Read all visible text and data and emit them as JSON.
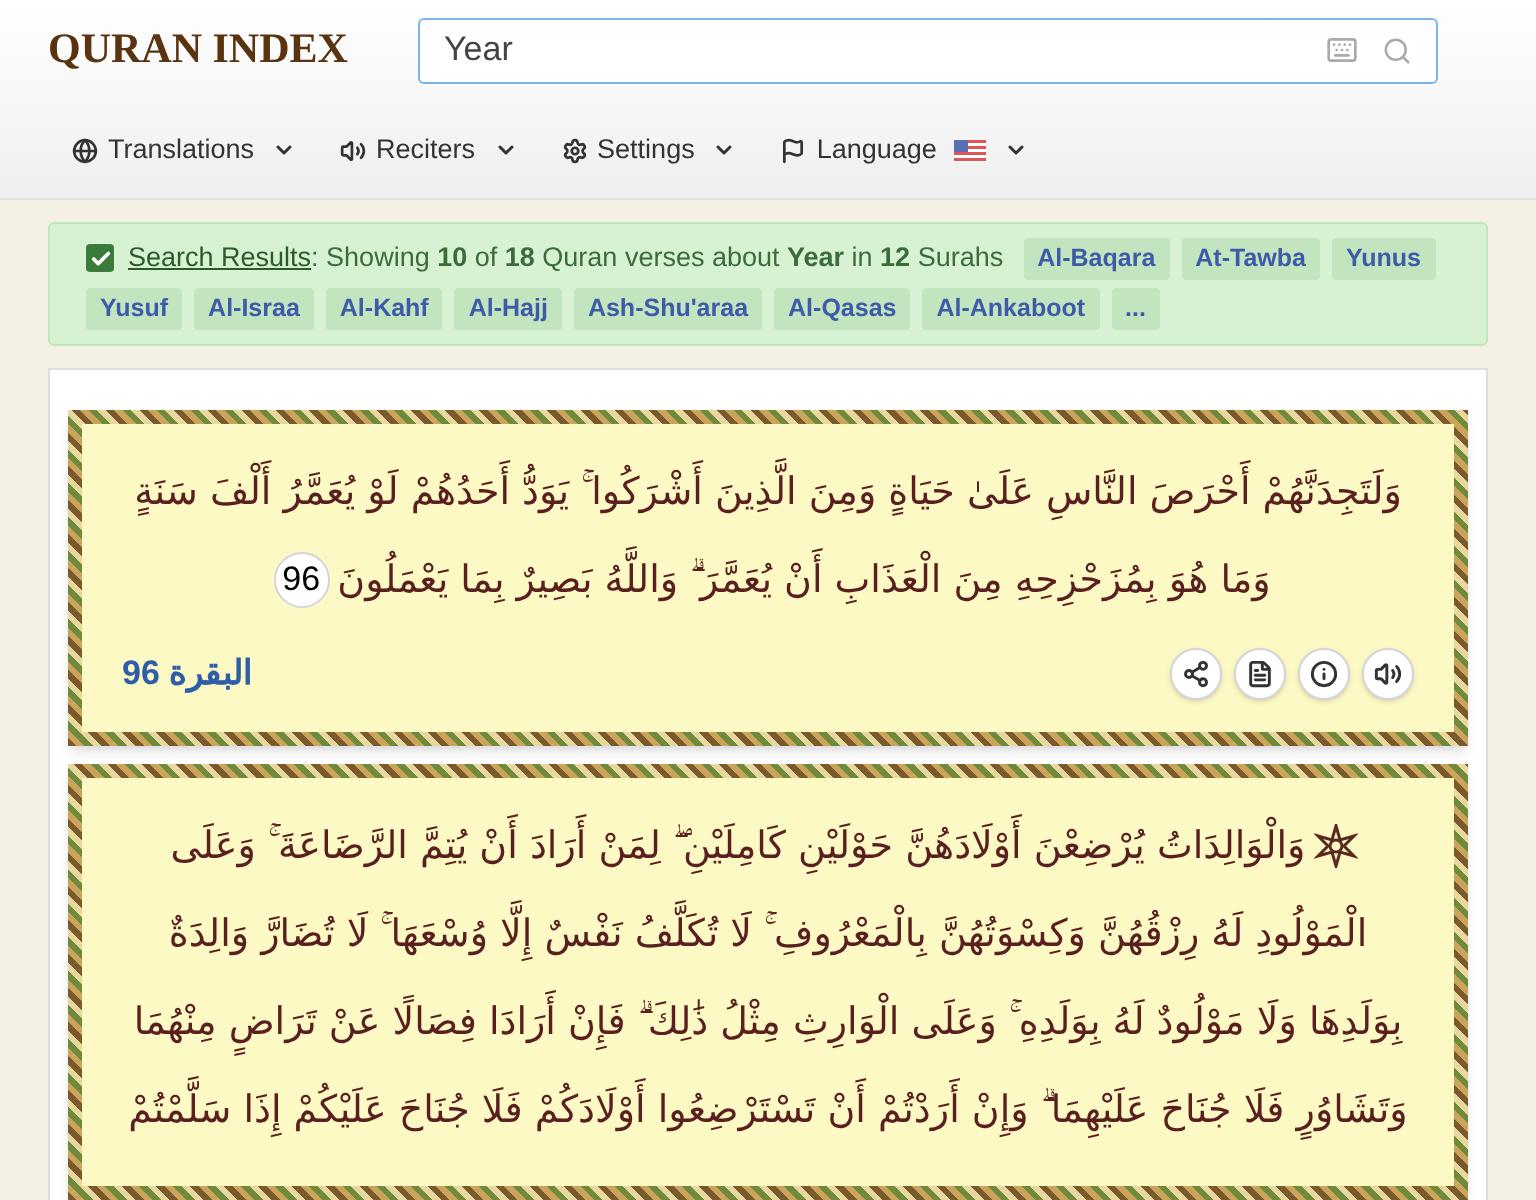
{
  "logo": "QURAN INDEX",
  "search": {
    "value": "Year"
  },
  "menu": [
    {
      "label": "Translations",
      "flag": false
    },
    {
      "label": "Reciters",
      "flag": false
    },
    {
      "label": "Settings",
      "flag": false
    },
    {
      "label": "Language",
      "flag": true
    }
  ],
  "results": {
    "checked": true,
    "link": "Search Results",
    "summary": ": Showing **10** of **18** Quran verses about **Year** in **12** Surahs",
    "surahs": [
      "Al-Baqara",
      "At-Tawba",
      "Yunus",
      "Yusuf",
      "Al-Israa",
      "Al-Kahf",
      "Al-Hajj",
      "Ash-Shu'araa",
      "Al-Qasas",
      "Al-Ankaboot",
      "..."
    ]
  },
  "verses": [
    {
      "text": "وَلَتَجِدَنَّهُمْ أَحْرَصَ النَّاسِ عَلَىٰ حَيَاةٍ وَمِنَ الَّذِينَ أَشْرَكُوا ۚ يَوَدُّ أَحَدُهُمْ لَوْ يُعَمَّرُ أَلْفَ سَنَةٍ وَمَا هُوَ بِمُزَحْزِحِهِ مِنَ الْعَذَابِ أَنْ يُعَمَّرَ ۗ وَاللَّهُ بَصِيرٌ بِمَا يَعْمَلُونَ",
      "number": "96",
      "surah": "البقرة",
      "ref": "96",
      "ornament": false
    },
    {
      "text": "وَالْوَالِدَاتُ يُرْضِعْنَ أَوْلَادَهُنَّ حَوْلَيْنِ كَامِلَيْنِ ۖ لِمَنْ أَرَادَ أَنْ يُتِمَّ الرَّضَاعَةَ ۚ وَعَلَى الْمَوْلُودِ لَهُ رِزْقُهُنَّ وَكِسْوَتُهُنَّ بِالْمَعْرُوفِ ۚ لَا تُكَلَّفُ نَفْسٌ إِلَّا وُسْعَهَا ۚ لَا تُضَارَّ وَالِدَةٌ بِوَلَدِهَا وَلَا مَوْلُودٌ لَهُ بِوَلَدِهِ ۚ وَعَلَى الْوَارِثِ مِثْلُ ذَٰلِكَ ۗ فَإِنْ أَرَادَا فِصَالًا عَنْ تَرَاضٍ مِنْهُمَا وَتَشَاوُرٍ فَلَا جُنَاحَ عَلَيْهِمَا ۗ وَإِنْ أَرَدْتُمْ أَنْ تَسْتَرْضِعُوا أَوْلَادَكُمْ فَلَا جُنَاحَ عَلَيْكُمْ إِذَا سَلَّمْتُمْ",
      "ornament": true
    }
  ]
}
